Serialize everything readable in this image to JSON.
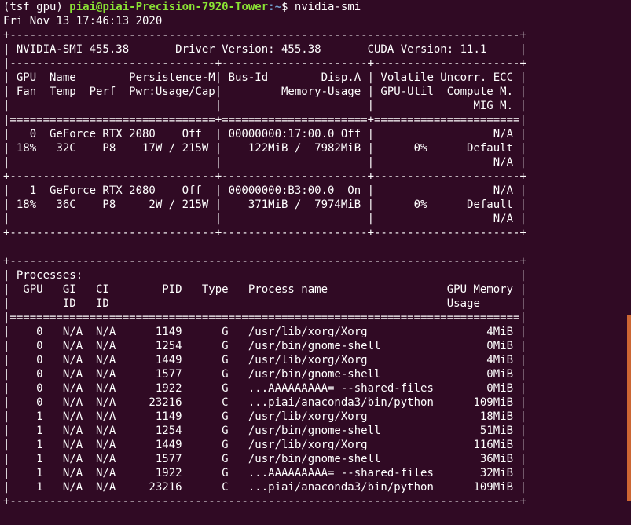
{
  "terminal": {
    "prompt": {
      "env": "(tsf_gpu) ",
      "user_host": "piai@piai-Precision-7920-Tower",
      "path": ":~",
      "symbol": "$ ",
      "command": "nvidia-smi"
    },
    "date_line": "Fri Nov 13 17:46:13 2020",
    "lines": [
      "+-----------------------------------------------------------------------------+",
      "| NVIDIA-SMI 455.38       Driver Version: 455.38       CUDA Version: 11.1     |",
      "|-------------------------------+----------------------+----------------------+",
      "| GPU  Name        Persistence-M| Bus-Id        Disp.A | Volatile Uncorr. ECC |",
      "| Fan  Temp  Perf  Pwr:Usage/Cap|         Memory-Usage | GPU-Util  Compute M. |",
      "|                               |                      |               MIG M. |",
      "|===============================+======================+======================|",
      "|   0  GeForce RTX 2080    Off  | 00000000:17:00.0 Off |                  N/A |",
      "| 18%   32C    P8    17W / 215W |    122MiB /  7982MiB |      0%      Default |",
      "|                               |                      |                  N/A |",
      "+-------------------------------+----------------------+----------------------+",
      "|   1  GeForce RTX 2080    Off  | 00000000:B3:00.0  On |                  N/A |",
      "| 18%   36C    P8     2W / 215W |    371MiB /  7974MiB |      0%      Default |",
      "|                               |                      |                  N/A |",
      "+-------------------------------+----------------------+----------------------+",
      "",
      "+-----------------------------------------------------------------------------+",
      "| Processes:                                                                  |",
      "|  GPU   GI   CI        PID   Type   Process name                  GPU Memory |",
      "|        ID   ID                                                   Usage      |",
      "|=============================================================================|",
      "|    0   N/A  N/A      1149      G   /usr/lib/xorg/Xorg                  4MiB |",
      "|    0   N/A  N/A      1254      G   /usr/bin/gnome-shell                0MiB |",
      "|    0   N/A  N/A      1449      G   /usr/lib/xorg/Xorg                  4MiB |",
      "|    0   N/A  N/A      1577      G   /usr/bin/gnome-shell                0MiB |",
      "|    0   N/A  N/A      1922      G   ...AAAAAAAAA= --shared-files        0MiB |",
      "|    0   N/A  N/A     23216      C   ...piai/anaconda3/bin/python      109MiB |",
      "|    1   N/A  N/A      1149      G   /usr/lib/xorg/Xorg                 18MiB |",
      "|    1   N/A  N/A      1254      G   /usr/bin/gnome-shell               51MiB |",
      "|    1   N/A  N/A      1449      G   /usr/lib/xorg/Xorg                116MiB |",
      "|    1   N/A  N/A      1577      G   /usr/bin/gnome-shell               36MiB |",
      "|    1   N/A  N/A      1922      G   ...AAAAAAAAA= --shared-files       32MiB |",
      "|    1   N/A  N/A     23216      C   ...piai/anaconda3/bin/python      109MiB |",
      "+-----------------------------------------------------------------------------+"
    ]
  },
  "colors": {
    "background": "#300a24",
    "foreground": "#ffffff",
    "prompt_user": "#8ae234",
    "prompt_path": "#729fcf",
    "scroll_indicator": "#cc6633"
  }
}
